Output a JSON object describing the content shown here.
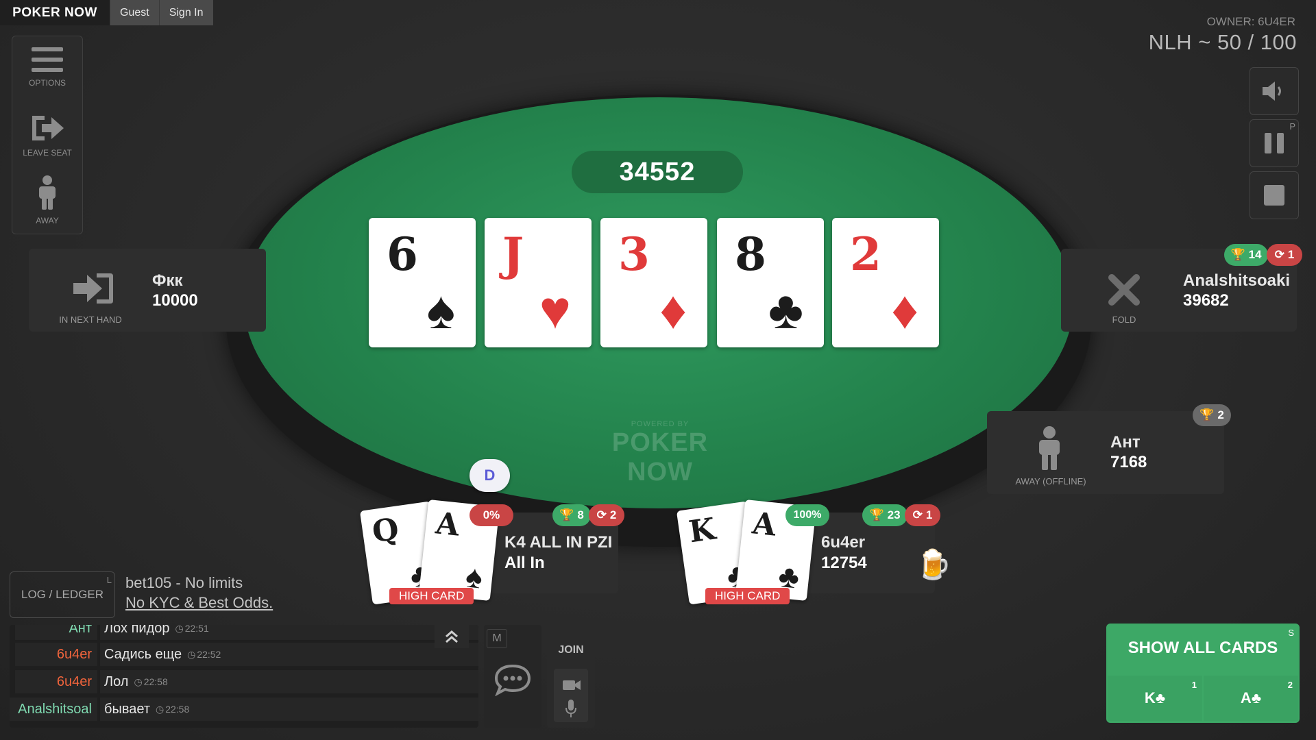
{
  "brand": {
    "logo_text": "POKER NOW"
  },
  "topbar": {
    "guest_label": "Guest",
    "signin_label": "Sign In"
  },
  "left_panel": {
    "options_label": "OPTIONS",
    "leave_seat_label": "LEAVE SEAT",
    "away_label": "AWAY"
  },
  "header": {
    "owner": "OWNER: 6U4ER",
    "game": "NLH ~ 50 / 100"
  },
  "right_controls": {
    "pause_key": "P"
  },
  "table": {
    "pot": "34552",
    "board": [
      {
        "rank": "6",
        "suit": "♠",
        "color": "black"
      },
      {
        "rank": "J",
        "suit": "♥",
        "color": "red"
      },
      {
        "rank": "3",
        "suit": "♦",
        "color": "red"
      },
      {
        "rank": "8",
        "suit": "♣",
        "color": "black"
      },
      {
        "rank": "2",
        "suit": "♦",
        "color": "red"
      }
    ],
    "powered_small": "POWERED BY",
    "powered_big": "POKER NOW"
  },
  "seats": {
    "left": {
      "name": "Фкк",
      "stack": "10000",
      "status": "IN NEXT HAND"
    },
    "right": {
      "name": "Analshitsoaki",
      "stack": "39682",
      "status": "FOLD",
      "wins": "14",
      "rebuys": "1"
    },
    "right_low": {
      "name": "Ант",
      "stack": "7168",
      "status": "AWAY (OFFLINE)",
      "wins": "2"
    },
    "k4": {
      "name": "K4 ALL IN PZI",
      "stack": "All In",
      "equity": "0%",
      "wins": "8",
      "rebuys": "2",
      "hand": "HIGH CARD",
      "cards": [
        {
          "rank": "Q",
          "suit": "♣"
        },
        {
          "rank": "A",
          "suit": "♠"
        }
      ]
    },
    "me": {
      "name": "6u4er",
      "stack": "12754",
      "equity": "100%",
      "wins": "23",
      "rebuys": "1",
      "hand": "HIGH CARD",
      "cards": [
        {
          "rank": "K",
          "suit": "♣"
        },
        {
          "rank": "A",
          "suit": "♣"
        }
      ]
    }
  },
  "dealer": "D",
  "log": {
    "button_label": "LOG / LEDGER",
    "key": "L"
  },
  "promo": {
    "line1": "bet105 - No limits",
    "line2": "No KYC & Best Odds."
  },
  "chat": {
    "rows": [
      {
        "name": "Ант",
        "name_color": "#7fd9b0",
        "msg": "Лох пидор",
        "time": "22:51"
      },
      {
        "name": "6u4er",
        "name_color": "#f0643c",
        "msg": "Садись еще",
        "time": "22:52"
      },
      {
        "name": "6u4er",
        "name_color": "#f0643c",
        "msg": "Лол",
        "time": "22:58"
      },
      {
        "name": "Analshitsoal",
        "name_color": "#7fd9b0",
        "msg": "бывает",
        "time": "22:58"
      }
    ],
    "mute_key": "M"
  },
  "join": {
    "label": "JOIN"
  },
  "show_all": {
    "title": "SHOW ALL CARDS",
    "key": "S",
    "card1": "K♣",
    "card1_key": "1",
    "card2": "A♣",
    "card2_key": "2"
  },
  "colors": {
    "felt": "#23824c",
    "accent_green": "#3da866",
    "accent_red": "#e04848"
  }
}
